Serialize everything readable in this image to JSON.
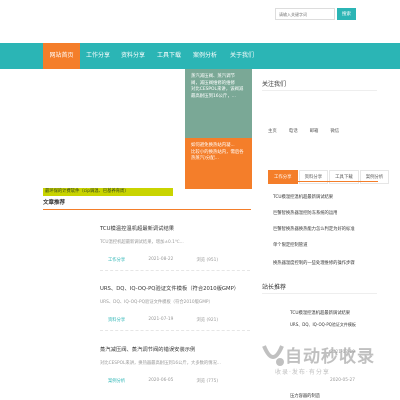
{
  "search": {
    "placeholder": "请输入关键字词",
    "button_label": "搜索"
  },
  "nav": {
    "items": [
      {
        "label": "网站首页",
        "active": true
      },
      {
        "label": "工作分享",
        "active": false
      },
      {
        "label": "资料分享",
        "active": false
      },
      {
        "label": "工具下载",
        "active": false
      },
      {
        "label": "案例分析",
        "active": false
      },
      {
        "label": "关于我们",
        "active": false
      }
    ]
  },
  "slides": [
    {
      "lines": [
        "蒸汽减压阀、蒸汽调节",
        "阀，减压阀维修的维修",
        "对比CESPOL来讲，该阀减",
        "最高耐压到16公斤，..."
      ]
    },
    {
      "lines": [
        "如何避免换热站内凝...",
        "",
        "比较小的换热站内，需后各",
        "热蒸汽)分配..."
      ]
    }
  ],
  "marquee": {
    "text": "最环保的计费软件（cip调温、巴基养育周）"
  },
  "main": {
    "section_title": "文章推荐",
    "articles": [
      {
        "title": "TCU模温控温机超最新调试结果",
        "desc": "TCU温控机超最新调试结果，增加±0.1℃...",
        "category": "工作分享",
        "date": "2021-08-22",
        "views": "浏览 (951)"
      },
      {
        "title": "URS、DQ、IQ-OQ-PQ验证文件模板（符合2010版GMP）",
        "desc": "URS、DQ、IQ-OQ-PQ验证文件模板（符合2010版GMP）",
        "category": "资料分享",
        "date": "2021-07-19",
        "views": "浏览 (921)"
      },
      {
        "title": "蒸汽减压阀、蒸汽调节阀的错误安装示例",
        "desc": "对比CESPOL来讲，换热器最高耐压到16公斤，大多数的情况...",
        "category": "案例分析",
        "date": "2020-06-05",
        "views": "浏览 (775)"
      }
    ]
  },
  "sidebar": {
    "about_title": "关注我们",
    "contacts": [
      "主页",
      "电话",
      "邮箱",
      "微信"
    ],
    "tabs": [
      {
        "label": "工作分享",
        "active": true
      },
      {
        "label": "资料分享",
        "active": false
      },
      {
        "label": "工具下载",
        "active": false
      },
      {
        "label": "案例分析",
        "active": false
      }
    ],
    "list": [
      "TCU模温控温机超最新调试结果",
      "巨蟹智换热器温控防冻系统的运用",
      "巨蟹智换热器换热能力怎么判定为好的标准",
      "单个限定控制管道",
      "换热器温度控制的一些处理维修的操作步骤"
    ],
    "recommend_title": "站长推荐",
    "recommend": [
      {
        "title": "TCU模温控温机超最新调试结果",
        "date": ""
      },
      {
        "title": "URS、DQ、IQ-OQ-PQ验证文件模板",
        "date": "2021-07-19"
      },
      {
        "title": "",
        "date": "2020-05-27"
      },
      {
        "title": "压力容器的制造",
        "date": ""
      }
    ]
  },
  "watermark": {
    "text": "自动秒收录",
    "subtext": "收录·发布·有分享"
  },
  "colors": {
    "accent": "#2bb5b5",
    "orange": "#f47e2a",
    "green_slide": "#7aa896",
    "marquee": "#c9d400"
  }
}
